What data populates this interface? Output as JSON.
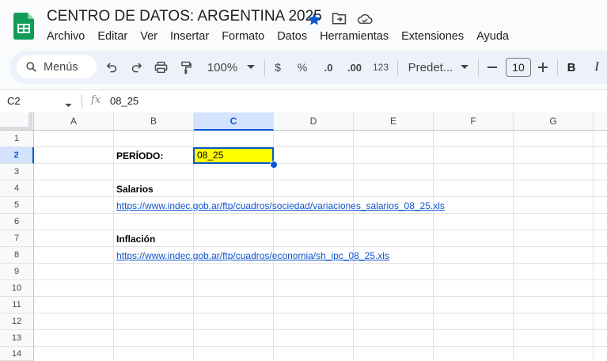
{
  "document": {
    "title": "CENTRO DE DATOS: ARGENTINA 2025"
  },
  "menu": [
    "Archivo",
    "Editar",
    "Ver",
    "Insertar",
    "Formato",
    "Datos",
    "Herramientas",
    "Extensiones",
    "Ayuda"
  ],
  "toolbar": {
    "search_label": "Menús",
    "zoom": "100%",
    "currency": "$",
    "percent": "%",
    "decrease_decimals": ".0",
    "increase_decimals": ".00",
    "number_format": "123",
    "font_name": "Predet...",
    "font_size": "10",
    "bold": "B",
    "italic": "I"
  },
  "formula_bar": {
    "name_box": "C2",
    "fx": "fx",
    "value": "08_25"
  },
  "grid": {
    "columns": [
      "A",
      "B",
      "C",
      "D",
      "E",
      "F",
      "G"
    ],
    "rows": [
      "1",
      "2",
      "3",
      "4",
      "5",
      "6",
      "7",
      "8",
      "9",
      "10",
      "11",
      "12",
      "13",
      "14"
    ],
    "selected_column": "C",
    "selected_row": "2",
    "cells": {
      "B2": "PERÍODO:",
      "C2": "08_25",
      "B4": "Salarios",
      "B5": "https://www.indec.gob.ar/ftp/cuadros/sociedad/variaciones_salarios_08_25.xls",
      "B7": "Inflación",
      "B8": "https://www.indec.gob.ar/ftp/cuadros/economia/sh_ipc_08_25.xls"
    },
    "active_cell_fill": "#ffff00"
  },
  "colors": {
    "accent": "#0b57d0",
    "sheets_green": "#0f9d58",
    "toolbar_bg": "#edf2fa"
  }
}
